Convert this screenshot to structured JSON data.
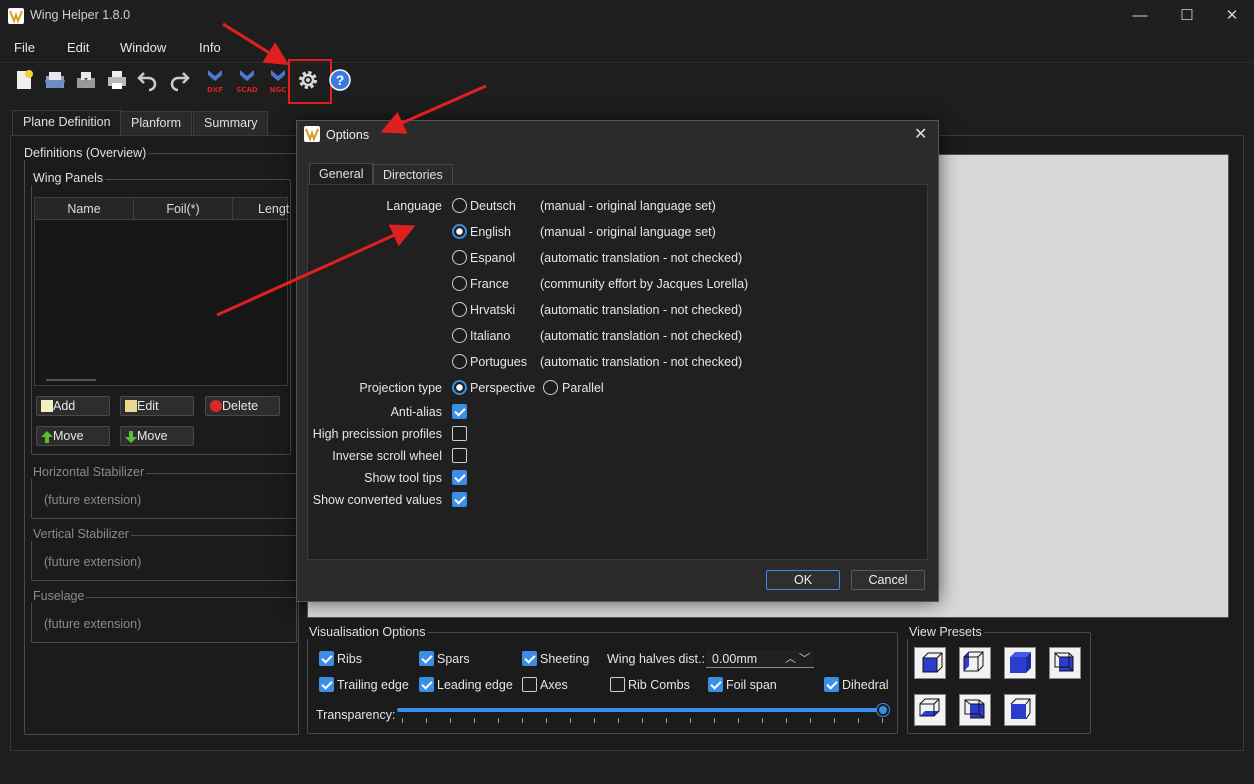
{
  "window": {
    "title": "Wing Helper 1.8.0",
    "minimize": "—",
    "maximize": "☐",
    "close": "✕"
  },
  "menu": [
    "File",
    "Edit",
    "Window",
    "Info"
  ],
  "toolbar": {
    "icons": [
      "new-file-icon",
      "open-icon",
      "save-icon",
      "print-icon",
      "undo-icon",
      "redo-icon",
      "export-dxf-icon",
      "export-scad-icon",
      "export-ngc-icon",
      "settings-gear-icon",
      "help-icon"
    ],
    "dxf": "DXF",
    "scad": "SCAD",
    "ngc": "NGC"
  },
  "main_tabs": [
    "Plane Definition",
    "Planform",
    "Summary"
  ],
  "definitions": {
    "title": "Definitions (Overview)",
    "wing_panels": "Wing Panels",
    "columns": [
      "Name",
      "Foil(*)",
      "Lengt"
    ],
    "buttons": {
      "add": "Add",
      "edit": "Edit",
      "delete": "Delete",
      "move_up": "Move",
      "move_down": "Move"
    },
    "horizontal": "Horizontal Stabilizer",
    "vertical": "Vertical Stabilizer",
    "fuselage": "Fuselage",
    "future": "(future extension)"
  },
  "dialog": {
    "title": "Options",
    "tabs": [
      "General",
      "Directories"
    ],
    "language_label": "Language",
    "languages": [
      {
        "name": "Deutsch",
        "desc": "(manual - original language set)",
        "selected": false
      },
      {
        "name": "English",
        "desc": "(manual - original language set)",
        "selected": true
      },
      {
        "name": "Espanol",
        "desc": "(automatic translation - not checked)",
        "selected": false
      },
      {
        "name": "France",
        "desc": "(community effort by Jacques Lorella)",
        "selected": false
      },
      {
        "name": "Hrvatski",
        "desc": "(automatic translation - not checked)",
        "selected": false
      },
      {
        "name": "Italiano",
        "desc": "(automatic translation - not checked)",
        "selected": false
      },
      {
        "name": "Portugues",
        "desc": "(automatic translation - not checked)",
        "selected": false
      }
    ],
    "projection_label": "Projection type",
    "projection": {
      "perspective": "Perspective",
      "parallel": "Parallel",
      "selected": "Perspective"
    },
    "checks": [
      {
        "label": "Anti-alias",
        "checked": true
      },
      {
        "label": "High precission profiles",
        "checked": false
      },
      {
        "label": "Inverse scroll wheel",
        "checked": false
      },
      {
        "label": "Show tool tips",
        "checked": true
      },
      {
        "label": "Show converted values",
        "checked": true
      }
    ],
    "ok": "OK",
    "cancel": "Cancel"
  },
  "visualisation": {
    "title": "Visualisation Options",
    "ribs": "Ribs",
    "spars": "Spars",
    "sheeting": "Sheeting",
    "wing_halves_label": "Wing halves dist.:",
    "wing_halves_value": "0.00mm",
    "trailing": "Trailing edge",
    "leading": "Leading edge",
    "axes": "Axes",
    "rib_combs": "Rib Combs",
    "foil_span": "Foil span",
    "dihedral": "Dihedral",
    "transparency": "Transparency:",
    "transparency_level": 1.0
  },
  "view_presets": {
    "title": "View Presets"
  },
  "colors": {
    "accent": "#3a8ee6",
    "annotation": "#e02020"
  }
}
